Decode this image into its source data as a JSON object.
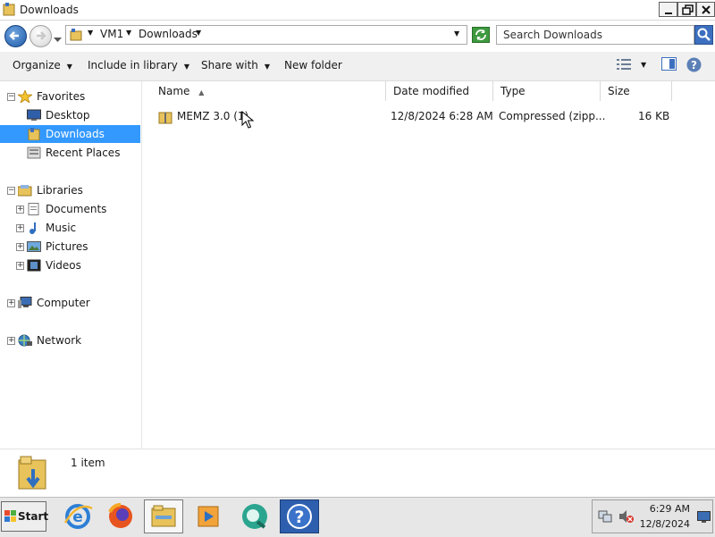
{
  "window": {
    "title": "Downloads"
  },
  "address": {
    "crumbs": [
      "VM1",
      "Downloads"
    ],
    "search_placeholder": "Search Downloads"
  },
  "toolbar": {
    "organize": "Organize",
    "include_in_library": "Include in library",
    "share_with": "Share with",
    "new_folder": "New folder"
  },
  "nav": {
    "favorites": "Favorites",
    "desktop": "Desktop",
    "downloads": "Downloads",
    "recent_places": "Recent Places",
    "libraries": "Libraries",
    "documents": "Documents",
    "music": "Music",
    "pictures": "Pictures",
    "videos": "Videos",
    "computer": "Computer",
    "network": "Network"
  },
  "columns": {
    "name": "Name",
    "date_modified": "Date modified",
    "type": "Type",
    "size": "Size"
  },
  "files": [
    {
      "name": "MEMZ 3.0 (1)",
      "date_modified": "12/8/2024 6:28 AM",
      "type": "Compressed (zipp...",
      "size": "16 KB"
    }
  ],
  "status": {
    "item_count": "1 item"
  },
  "taskbar": {
    "start_label": "Start",
    "clock_time": "6:29 AM",
    "clock_date": "12/8/2024"
  },
  "colors": {
    "selection": "#3399ff",
    "commandbar": "#f0f0f0",
    "taskbar": "#e7e7e7"
  }
}
